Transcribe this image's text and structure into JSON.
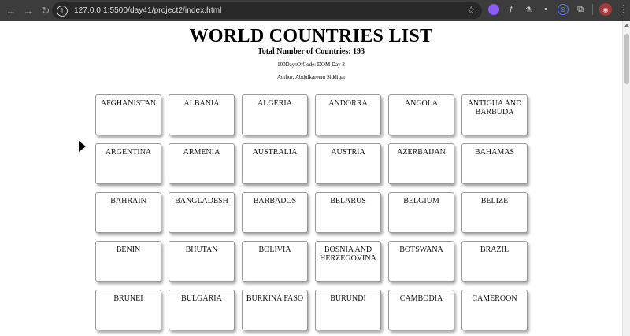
{
  "browser": {
    "url": "127.0.0.1:5500/day41/project2/index.html",
    "back_icon": "←",
    "forward_icon": "→",
    "reload_icon": "↻",
    "site_info_icon": "i",
    "star_icon": "☆",
    "menu_icon": "⋮"
  },
  "page": {
    "title": "WORLD COUNTRIES LIST",
    "subtitle": "Total Number of Countries: 193",
    "challenge": "100DaysOfCode: DOM Day 2",
    "author": "Author: Abdulkareem Siddiqat"
  },
  "countries": [
    "AFGHANISTAN",
    "ALBANIA",
    "ALGERIA",
    "ANDORRA",
    "ANGOLA",
    "ANTIGUA AND BARBUDA",
    "ARGENTINA",
    "ARMENIA",
    "AUSTRALIA",
    "AUSTRIA",
    "AZERBAIJAN",
    "BAHAMAS",
    "BAHRAIN",
    "BANGLADESH",
    "BARBADOS",
    "BELARUS",
    "BELGIUM",
    "BELIZE",
    "BENIN",
    "BHUTAN",
    "BOLIVIA",
    "BOSNIA AND HERZEGOVINA",
    "BOTSWANA",
    "BRAZIL",
    "BRUNEI",
    "BULGARIA",
    "BURKINA FASO",
    "BURUNDI",
    "CAMBODIA",
    "CAMEROON"
  ],
  "colors": {
    "chrome_bg": "#3c3c3c",
    "omnibox_bg": "#282828",
    "card_border": "#9a9a9a"
  }
}
